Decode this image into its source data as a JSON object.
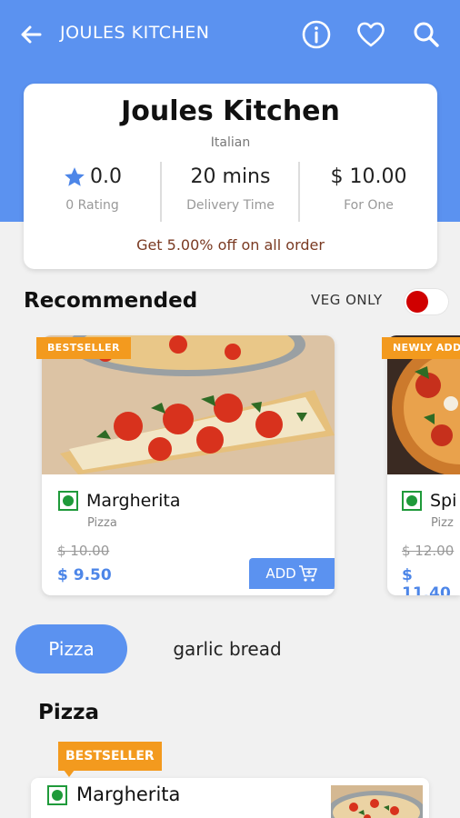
{
  "header": {
    "title": "JOULES KITCHEN",
    "back_icon": "arrow-left-icon",
    "icons": [
      "info-icon",
      "heart-icon",
      "search-icon"
    ]
  },
  "restaurant": {
    "name": "Joules Kitchen",
    "cuisine": "Italian",
    "rating_value": "0.0",
    "rating_label": "0 Rating",
    "delivery_value": "20 mins",
    "delivery_label": "Delivery Time",
    "price_value": "$ 10.00",
    "price_label": "For One",
    "offer": "Get 5.00% off on all order"
  },
  "recommended": {
    "title": "Recommended",
    "veg_only_label": "VEG ONLY",
    "veg_only_on": true,
    "items": [
      {
        "badge": "BESTSELLER",
        "name": "Margherita",
        "category": "Pizza",
        "old_price": "$ 10.00",
        "price": "$ 9.50",
        "add_label": "ADD"
      },
      {
        "badge": "NEWLY ADD",
        "name": "Spi",
        "category": "Pizz",
        "old_price": "$ 12.00",
        "price": "$ 11.40"
      }
    ]
  },
  "categories": {
    "tabs": [
      "Pizza",
      "garlic bread"
    ],
    "active": "Pizza"
  },
  "menu_section": {
    "title": "Pizza",
    "items": [
      {
        "badge": "BESTSELLER",
        "name": "Margherita"
      }
    ]
  },
  "colors": {
    "primary": "#5b92f0",
    "badge": "#f39a1e",
    "veg": "#1f9a3a",
    "toggle_on": "#d00000",
    "offer_text": "#7a3a22"
  }
}
